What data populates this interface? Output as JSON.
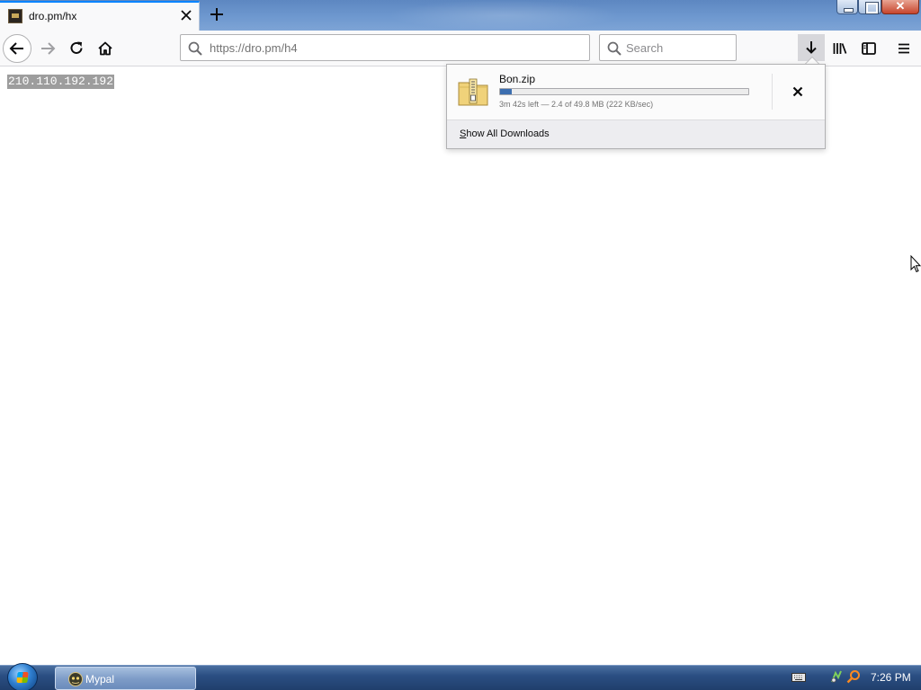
{
  "tab": {
    "title": "dro.pm/hx"
  },
  "urlbar": {
    "url": "https://dro.pm/h4"
  },
  "searchbar": {
    "placeholder": "Search"
  },
  "page": {
    "text": "210.110.192.192"
  },
  "downloads_panel": {
    "filename": "Bon.zip",
    "status": "3m 42s left — 2.4 of 49.8 MB (222 KB/sec)",
    "progress_fraction": 0.048,
    "show_all_access_key": "S",
    "show_all_rest": "how All Downloads"
  },
  "taskbar": {
    "app_label": "Mypal",
    "clock": "7:26 PM"
  },
  "icons": [
    "close-icon",
    "plus-icon",
    "back-arrow-icon",
    "forward-arrow-icon",
    "reload-icon",
    "home-icon",
    "search-icon",
    "download-arrow-icon",
    "library-icon",
    "sidebar-icon",
    "hamburger-menu-icon",
    "zip-archive-icon",
    "cancel-icon",
    "windows-start-icon",
    "keyboard-icon",
    "network-icon",
    "magnifier-icon",
    "mouse-pointer-icon"
  ],
  "colors": {
    "accent": "#0a84ff",
    "progress": "#3d6fb0",
    "selection": "#9d9d9d"
  }
}
